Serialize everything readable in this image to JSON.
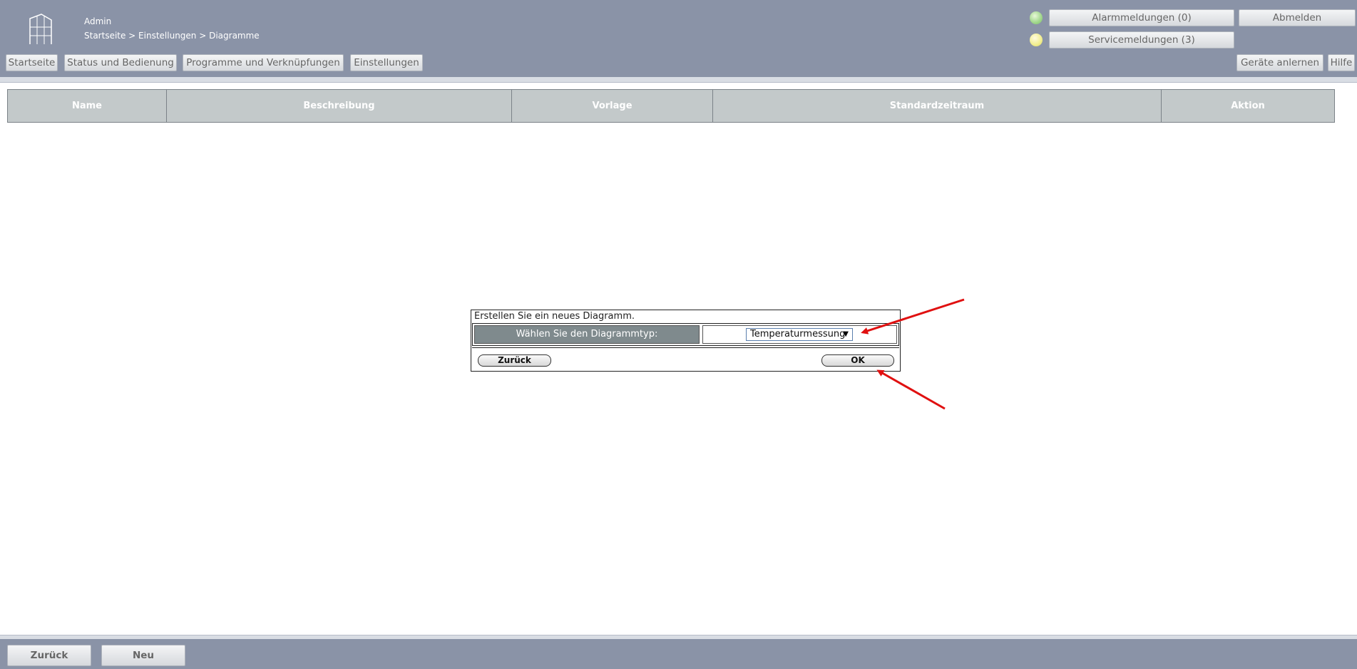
{
  "header": {
    "user": "Admin",
    "breadcrumb": "Startseite > Einstellungen > Diagramme",
    "nav": [
      {
        "label": "Startseite"
      },
      {
        "label": "Status und Bedienung"
      },
      {
        "label": "Programme und Verknüpfungen"
      },
      {
        "label": "Einstellungen"
      }
    ],
    "alarm_label": "Alarmmeldungen (0)",
    "service_label": "Servicemeldungen (3)",
    "logout_label": "Abmelden",
    "teach_label": "Geräte anlernen",
    "help_label": "Hilfe",
    "led_colors": {
      "alarm": "#9fd68a",
      "service": "#f1ee8e"
    }
  },
  "table": {
    "columns": [
      "Name",
      "Beschreibung",
      "Vorlage",
      "Standardzeitraum",
      "Aktion"
    ],
    "rows": []
  },
  "dialog": {
    "title": "Erstellen Sie ein neues Diagramm.",
    "label": "Wählen Sie den Diagrammtyp:",
    "selected": "Temperaturmessung",
    "back_label": "Zurück",
    "ok_label": "OK"
  },
  "footer": {
    "back_label": "Zurück",
    "new_label": "Neu"
  },
  "colors": {
    "header_bg": "#8a93a7",
    "annotation_arrow": "#e01010"
  }
}
